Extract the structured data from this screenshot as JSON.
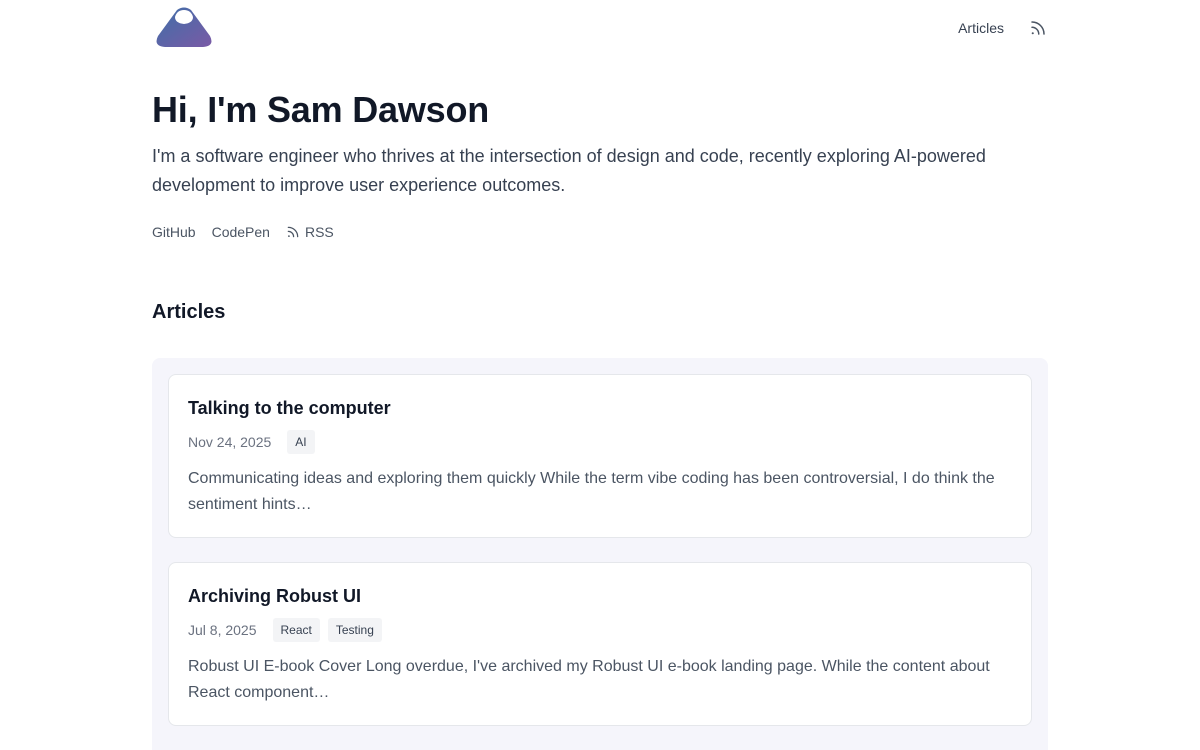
{
  "header": {
    "nav_articles": "Articles",
    "logo_icon": "mountain-logo-icon",
    "rss_icon": "rss-icon"
  },
  "hero": {
    "title": "Hi, I'm Sam Dawson",
    "bio": "I'm a software engineer who thrives at the intersection of design and code, recently exploring AI-powered development to improve user experience outcomes.",
    "links": {
      "github": "GitHub",
      "codepen": "CodePen",
      "rss": "RSS"
    }
  },
  "articles": {
    "section_title": "Articles",
    "items": [
      {
        "title": "Talking to the computer",
        "date": "Nov 24, 2025",
        "tags": [
          "AI"
        ],
        "excerpt": "Communicating ideas and exploring them quickly While the term vibe coding has been controversial, I do think the sentiment hints…"
      },
      {
        "title": "Archiving Robust UI",
        "date": "Jul 8, 2025",
        "tags": [
          "React",
          "Testing"
        ],
        "excerpt": "Robust UI E-book Cover Long overdue, I've archived my Robust UI e-book landing page. While the content about React component…"
      }
    ]
  },
  "colors": {
    "panel_bg": "#f5f5fb",
    "logo_gradient_start": "#3f6fa8",
    "logo_gradient_end": "#7a5aa6"
  }
}
